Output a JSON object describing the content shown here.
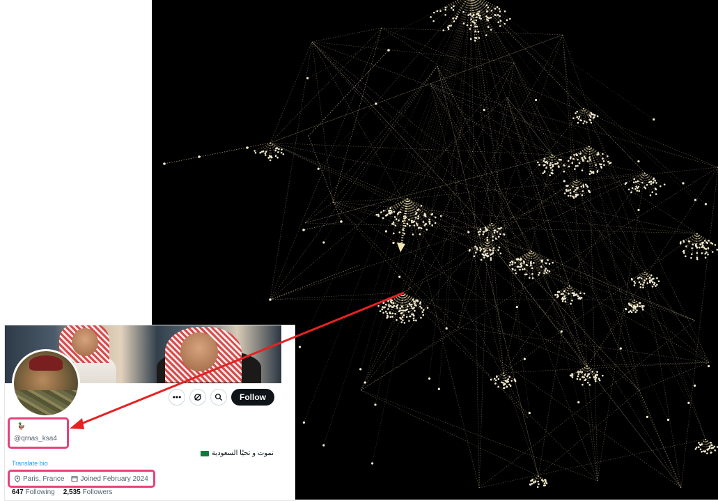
{
  "graph": {
    "background": "#000000",
    "node_color": "#f4ecd2",
    "edge_color": "#e8d8a8",
    "highlight_arrow_color": "#f2e6b0",
    "pointer_arrow_color": "#e52222"
  },
  "profile": {
    "handle": "@qrnas_ksa4",
    "name_glyph": "🦆",
    "bio": "نموت و تحيًا السعودية",
    "translate_label": "Translate bio",
    "location": "Paris, France",
    "joined": "Joined February 2024",
    "following_count": "647",
    "following_label": "Following",
    "followers_count": "2,535",
    "followers_label": "Followers",
    "follow_label": "Follow",
    "more_icon": "more-icon",
    "grok_icon": "grok-icon",
    "search_icon": "search-icon",
    "location_icon": "location-pin-icon",
    "calendar_icon": "calendar-icon",
    "highlight_color": "#e8417a"
  }
}
